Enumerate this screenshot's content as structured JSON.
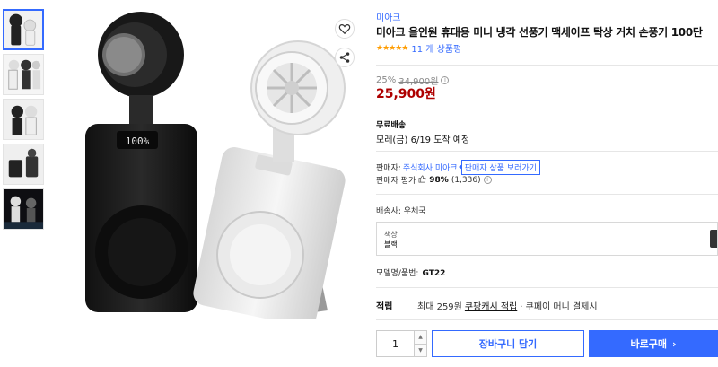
{
  "product": {
    "brand": "미아크",
    "title": "미아크 올인원 휴대용 미니 냉각 선풍기 맥세이프 탁상 거치 손풍기 100단",
    "stars": "★★★★★",
    "review_count": "11 개 상품평"
  },
  "price": {
    "discount_rate": "25%",
    "original_price": "34,900원",
    "sale_price": "25,900원"
  },
  "shipping": {
    "label": "무료배송",
    "arrival": "모레(금) 6/19 도착 예정"
  },
  "seller": {
    "label": "판매자:",
    "name": "주식회사 미아크",
    "tooltip": "판매자 상품 보러가기",
    "rating_label": "판매자 평가",
    "rating_pct": "98%",
    "rating_count": "(1,336)"
  },
  "delivery": {
    "label": "배송사:",
    "carrier": "우체국"
  },
  "option": {
    "label": "색상",
    "value": "블랙"
  },
  "model": {
    "label": "모델명/품번:",
    "value": "GT22"
  },
  "reward": {
    "head": "적립",
    "prefix": "최대 259원",
    "link": "쿠팡캐시 적립",
    "suffix": "· 쿠페이 머니 결제시"
  },
  "purchase": {
    "quantity": "1",
    "cart_label": "장바구니 담기",
    "buy_label": "바로구매",
    "buy_arrow": "›"
  },
  "main_image": {
    "display_text": "100%"
  },
  "colors": {
    "accent": "#346aff",
    "price": "#ae0000",
    "star": "#ff9c00"
  }
}
